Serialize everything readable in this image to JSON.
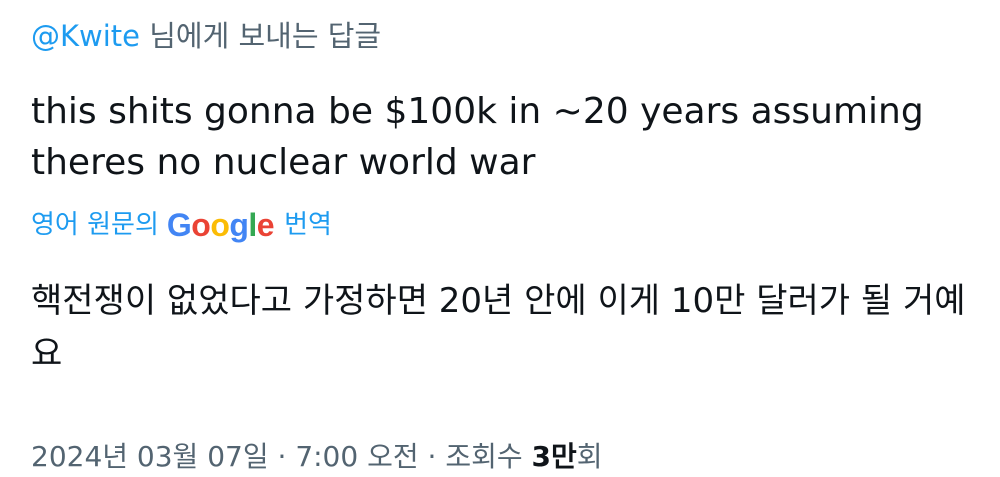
{
  "reply": {
    "handle": "@Kwite",
    "suffix": " 님에게 보내는 답글"
  },
  "tweet": {
    "text": "this shits gonna be $100k in ~20 years assuming theres no nuclear world war"
  },
  "translation": {
    "prefix": "영어 원문의",
    "google_letters": [
      "G",
      "o",
      "o",
      "g",
      "l",
      "e"
    ],
    "suffix": "번역",
    "text": "핵전쟁이 없었다고 가정하면 20년 안에 이게 10만 달러가 될 거예요"
  },
  "meta": {
    "date": "2024년 03월 07일",
    "sep1": " · ",
    "time": "7:00 오전",
    "sep2": " · ",
    "views_label": "조회수 ",
    "views_count": "3만",
    "views_suffix": "회"
  },
  "colors": {
    "link": "#1d9bf0",
    "secondary_text": "#536471",
    "primary_text": "#0f1419",
    "google_blue": "#4285f4",
    "google_red": "#ea4335",
    "google_yellow": "#fbbc05",
    "google_green": "#34a853"
  }
}
